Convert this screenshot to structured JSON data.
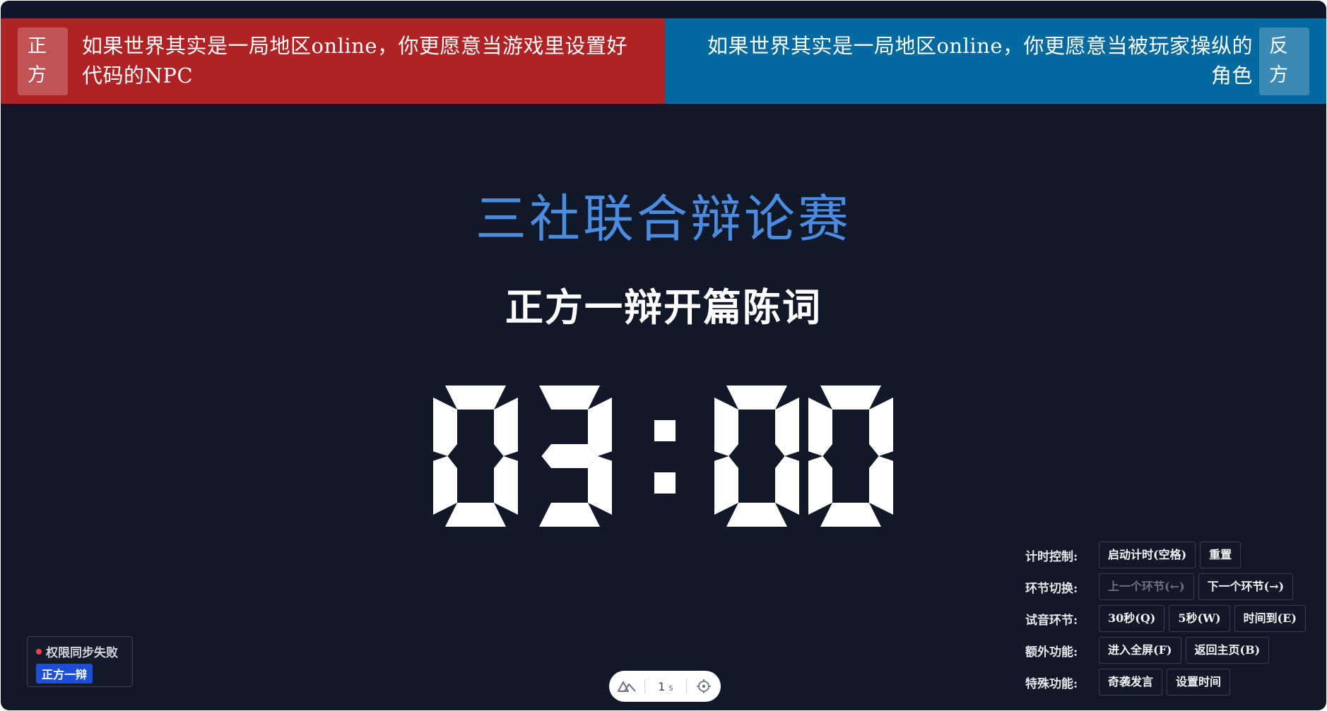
{
  "affirmative": {
    "side_label": "正\n方",
    "side_label_line1": "正",
    "side_label_line2": "方",
    "motion": "如果世界其实是一局地区online，你更愿意当游戏里设置好代码的NPC",
    "color": "#b12225"
  },
  "negative": {
    "side_label_line1": "反",
    "side_label_line2": "方",
    "motion_line1": "如果世界其实是一局地区online，你更愿意当被玩家操纵的",
    "motion_line2": "角色",
    "color": "#0369a1"
  },
  "event_title": "三社联合辩论赛",
  "stage_title": "正方一辩开篇陈词",
  "timer": {
    "display": "03:00",
    "minutes": "03",
    "seconds": "00",
    "color": "#ffffff"
  },
  "controls": {
    "timer_control": {
      "label": "计时控制:",
      "start": "启动计时(空格)",
      "reset": "重置"
    },
    "stage_switch": {
      "label": "环节切换:",
      "prev": "上一个环节(←)",
      "next": "下一个环节(→)"
    },
    "sound_test": {
      "label": "试音环节:",
      "thirty": "30秒(Q)",
      "five": "5秒(W)",
      "timeup": "时间到(E)"
    },
    "extra": {
      "label": "额外功能:",
      "fullscreen": "进入全屏(F)",
      "home": "返回主页(B)"
    },
    "special": {
      "label": "特殊功能:",
      "surprise": "奇袭发言",
      "set_time": "设置时间"
    }
  },
  "status": {
    "sync_text": "权限同步失败",
    "role": "正方一辩",
    "accent": "#ef4444"
  },
  "devtools": {
    "logo_icon": "nuxt-logo-icon",
    "render_time": "1",
    "render_unit": "s",
    "inspect_icon": "crosshair-icon"
  }
}
